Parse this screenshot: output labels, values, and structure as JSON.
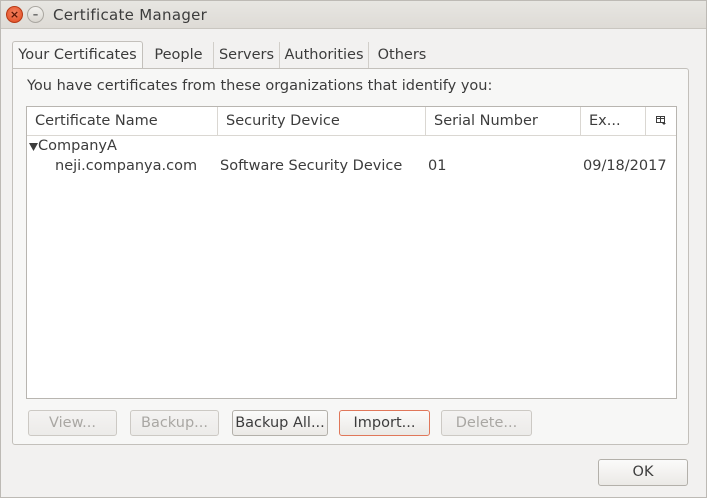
{
  "window": {
    "title": "Certificate Manager",
    "close_glyph": "×",
    "minimize_glyph": "–"
  },
  "tabs": [
    {
      "label": "Your Certificates",
      "active": true
    },
    {
      "label": "People"
    },
    {
      "label": "Servers"
    },
    {
      "label": "Authorities"
    },
    {
      "label": "Others"
    }
  ],
  "intro_text": "You have certificates from these organizations that identify you:",
  "table": {
    "columns": [
      "Certificate Name",
      "Security Device",
      "Serial Number",
      "Ex..."
    ],
    "group": {
      "name": "CompanyA"
    },
    "rows": [
      {
        "name": "neji.companya.com",
        "device": "Software Security Device",
        "serial": "01",
        "expires": "09/18/2017"
      }
    ]
  },
  "buttons": {
    "view": "View...",
    "backup": "Backup...",
    "backup_all": "Backup All...",
    "import": "Import...",
    "delete": "Delete...",
    "ok": "OK"
  },
  "icons": {
    "column_picker": "column-picker-icon",
    "expand": "triangle-down-icon"
  }
}
